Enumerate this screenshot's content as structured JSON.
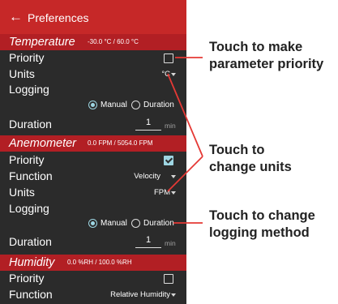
{
  "appbar": {
    "back_icon": "arrow-left-icon",
    "title": "Preferences"
  },
  "sections": {
    "temperature": {
      "name": "Temperature",
      "range": "-30.0 °C / 60.0 °C",
      "priority_label": "Priority",
      "priority_checked": false,
      "units_label": "Units",
      "units_value": "°C",
      "logging_label": "Logging",
      "logging_options": [
        "Manual",
        "Duration"
      ],
      "logging_selected": "Manual",
      "duration_label": "Duration",
      "duration_value": "1",
      "duration_unit": "min"
    },
    "anemometer": {
      "name": "Anemometer",
      "range": "0.0 FPM / 5054.0 FPM",
      "priority_label": "Priority",
      "priority_checked": true,
      "function_label": "Function",
      "function_value": "Velocity",
      "units_label": "Units",
      "units_value": "FPM",
      "logging_label": "Logging",
      "logging_options": [
        "Manual",
        "Duration"
      ],
      "logging_selected": "Manual",
      "duration_label": "Duration",
      "duration_value": "1",
      "duration_unit": "min"
    },
    "humidity": {
      "name": "Humidity",
      "range": "0.0 %RH / 100.0 %RH",
      "priority_label": "Priority",
      "priority_checked": false,
      "function_label": "Function",
      "function_value": "Relative Humidity"
    }
  },
  "annotations": {
    "priority": [
      "Touch to make",
      "parameter priority"
    ],
    "units": [
      "Touch to",
      "change units"
    ],
    "logging": [
      "Touch to change",
      "logging method"
    ]
  },
  "colors": {
    "appbar": "#c62828",
    "section_header": "#b21f24",
    "background": "#2b2b2b",
    "accent": "#9ed6e3",
    "callout_line": "#e53935"
  }
}
